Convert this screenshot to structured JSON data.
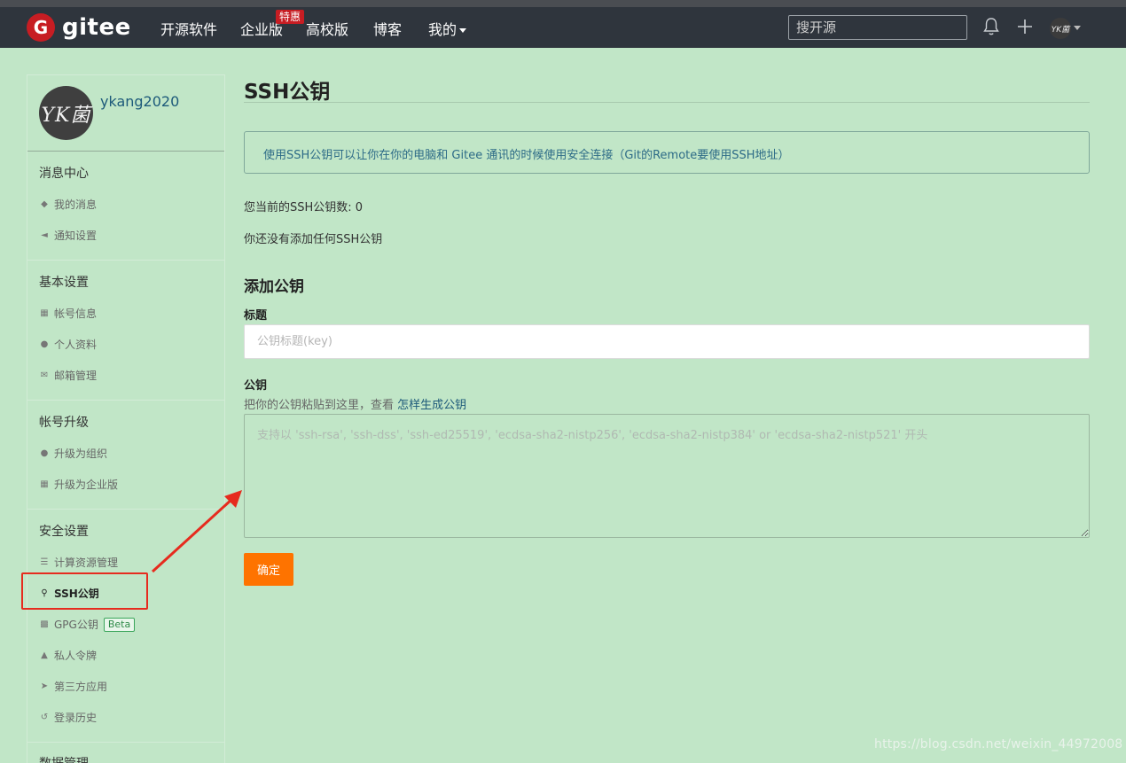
{
  "nav": {
    "logo_letter": "G",
    "logo_text": "gitee",
    "items": [
      "开源软件",
      "企业版",
      "高校版",
      "博客",
      "我的"
    ],
    "badge": "特惠",
    "search_placeholder": "搜开源",
    "avatar_text": "YK菌"
  },
  "sidebar": {
    "avatar_text": "YK菌",
    "username": "ykang2020",
    "sections": [
      {
        "title": "消息中心",
        "items": [
          "我的消息",
          "通知设置"
        ]
      },
      {
        "title": "基本设置",
        "items": [
          "帐号信息",
          "个人资料",
          "邮箱管理"
        ]
      },
      {
        "title": "帐号升级",
        "items": [
          "升级为组织",
          "升级为企业版"
        ]
      },
      {
        "title": "安全设置",
        "items": [
          "计算资源管理",
          "SSH公钥",
          "GPG公钥",
          "私人令牌",
          "第三方应用",
          "登录历史"
        ]
      },
      {
        "title": "数据管理",
        "items": []
      }
    ],
    "beta_badge": "Beta",
    "active_item": "SSH公钥"
  },
  "main": {
    "title": "SSH公钥",
    "info": "使用SSH公钥可以让你在你的电脑和 Gitee 通讯的时候使用安全连接（Git的Remote要使用SSH地址）",
    "count_text": "您当前的SSH公钥数: 0",
    "empty_text": "你还没有添加任何SSH公钥",
    "add_title": "添加公钥",
    "title_label": "标题",
    "title_placeholder": "公钥标题(key)",
    "key_label": "公钥",
    "key_hint": "把你的公钥粘贴到这里，查看",
    "key_hint_link": "怎样生成公钥",
    "key_placeholder": "支持以 'ssh-rsa', 'ssh-dss', 'ssh-ed25519', 'ecdsa-sha2-nistp256', 'ecdsa-sha2-nistp384' or 'ecdsa-sha2-nistp521' 开头",
    "submit": "确定"
  },
  "watermark": "https://blog.csdn.net/weixin_44972008",
  "colors": {
    "navbar": "#2f353d",
    "brand_red": "#c71d23",
    "page_bg": "#c1e6c7",
    "submit": "#fe7300",
    "annotation": "#e62b1e"
  }
}
